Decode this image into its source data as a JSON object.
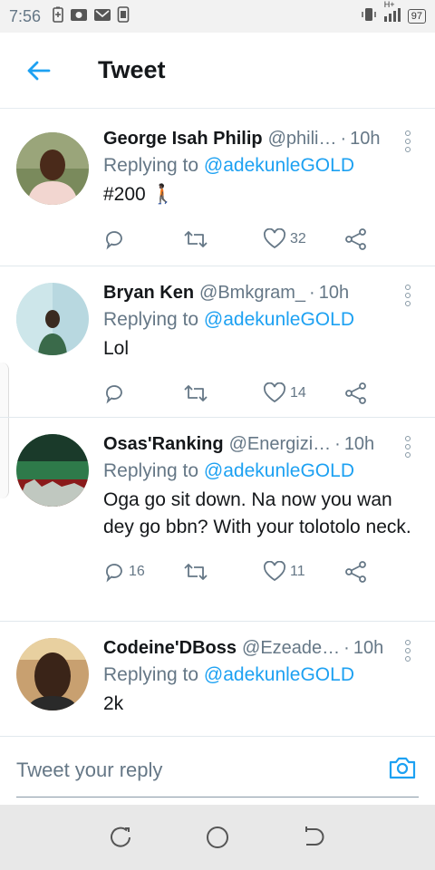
{
  "status_bar": {
    "time": "7:56",
    "network": "H+",
    "battery": "97"
  },
  "header": {
    "title": "Tweet"
  },
  "tweets": [
    {
      "name": "George Isah Philip",
      "handle": "@phili…",
      "time": "10h",
      "replying_prefix": "Replying to",
      "replying_to": "@adekunleGOLD",
      "text": "#200 🚶🏿",
      "replies": "",
      "likes": "32"
    },
    {
      "name": "Bryan Ken",
      "handle": "@Bmkgram_",
      "time": "10h",
      "replying_prefix": "Replying to",
      "replying_to": "@adekunleGOLD",
      "text": "Lol",
      "replies": "",
      "likes": "14"
    },
    {
      "name": "Osas'Ranking",
      "handle": "@Energizi…",
      "time": "10h",
      "replying_prefix": "Replying to",
      "replying_to": "@adekunleGOLD",
      "text": "Oga go sit down. Na now you wan dey go bbn? With your tolotolo neck.",
      "replies": "16",
      "likes": "11"
    },
    {
      "name": "Codeine'DBoss",
      "handle": "@Ezeade…",
      "time": "10h",
      "replying_prefix": "Replying to",
      "replying_to": "@adekunleGOLD",
      "text": "2k",
      "replies": "",
      "likes": ""
    }
  ],
  "reply_bar": {
    "placeholder": "Tweet your reply"
  },
  "colors": {
    "accent": "#1da1f2",
    "muted": "#657786"
  }
}
